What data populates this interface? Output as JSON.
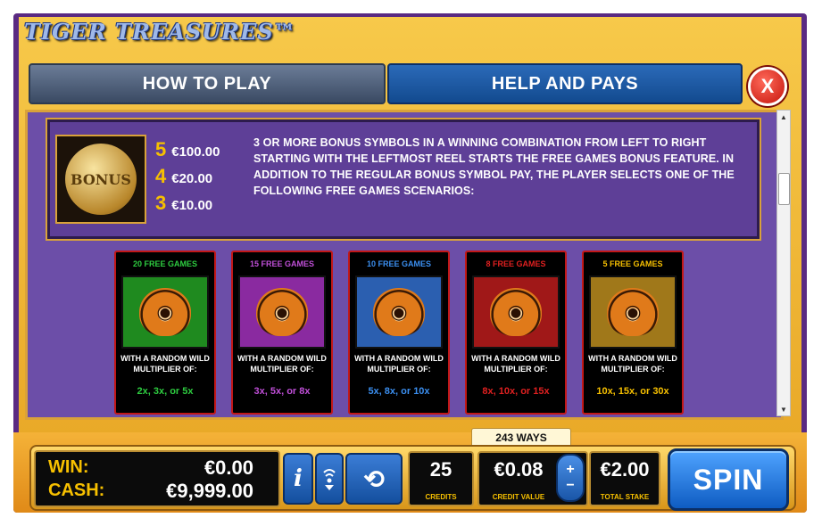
{
  "game": {
    "logo": "TIGER TREASURES™"
  },
  "tabs": [
    {
      "label": "HOW TO PLAY",
      "active": false
    },
    {
      "label": "HELP AND PAYS",
      "active": true
    }
  ],
  "close_label": "X",
  "bonus": {
    "symbol_text": "BONUS",
    "pays": [
      {
        "count": "5",
        "value": "€100.00"
      },
      {
        "count": "4",
        "value": "€20.00"
      },
      {
        "count": "3",
        "value": "€10.00"
      }
    ],
    "description": "3 OR MORE BONUS SYMBOLS IN A WINNING COMBINATION FROM LEFT TO RIGHT STARTING WITH THE LEFTMOST REEL STARTS THE FREE GAMES BONUS FEATURE. IN ADDITION TO THE REGULAR BONUS SYMBOL PAY, THE PLAYER SELECTS ONE OF THE FOLLOWING FREE GAMES SCENARIOS:"
  },
  "free_games": [
    {
      "title": "20 FREE GAMES",
      "line1": "WITH A RANDOM WILD",
      "line2": "MULTIPLIER OF:",
      "mult": "2x, 3x, or 5x",
      "color": "#2ecc40",
      "bg": "#1f8a1f"
    },
    {
      "title": "15 FREE GAMES",
      "line1": "WITH A RANDOM WILD",
      "line2": "MULTIPLIER OF:",
      "mult": "3x, 5x, or 8x",
      "color": "#c04fd8",
      "bg": "#8a2aa0"
    },
    {
      "title": "10 FREE GAMES",
      "line1": "WITH A RANDOM WILD",
      "line2": "MULTIPLIER OF:",
      "mult": "5x, 8x, or 10x",
      "color": "#3b8ff0",
      "bg": "#2b5fb0"
    },
    {
      "title": "8 FREE GAMES",
      "line1": "WITH A RANDOM WILD",
      "line2": "MULTIPLIER OF:",
      "mult": "8x, 10x, or 15x",
      "color": "#e02020",
      "bg": "#a01818"
    },
    {
      "title": "5 FREE GAMES",
      "line1": "WITH A RANDOM WILD",
      "line2": "MULTIPLIER OF:",
      "mult": "10x, 15x, or 30x",
      "color": "#f7c000",
      "bg": "#a0781a"
    }
  ],
  "bottom": {
    "ways": "243 WAYS",
    "win_label": "WIN:",
    "win_value": "€0.00",
    "cash_label": "CASH:",
    "cash_value": "€9,999.00",
    "credits_value": "25",
    "credits_label": "CREDITS",
    "credit_value": "€0.08",
    "credit_value_label": "CREDIT VALUE",
    "total_stake": "€2.00",
    "total_stake_label": "TOTAL STAKE",
    "spin_label": "SPIN",
    "info_label": "i"
  }
}
